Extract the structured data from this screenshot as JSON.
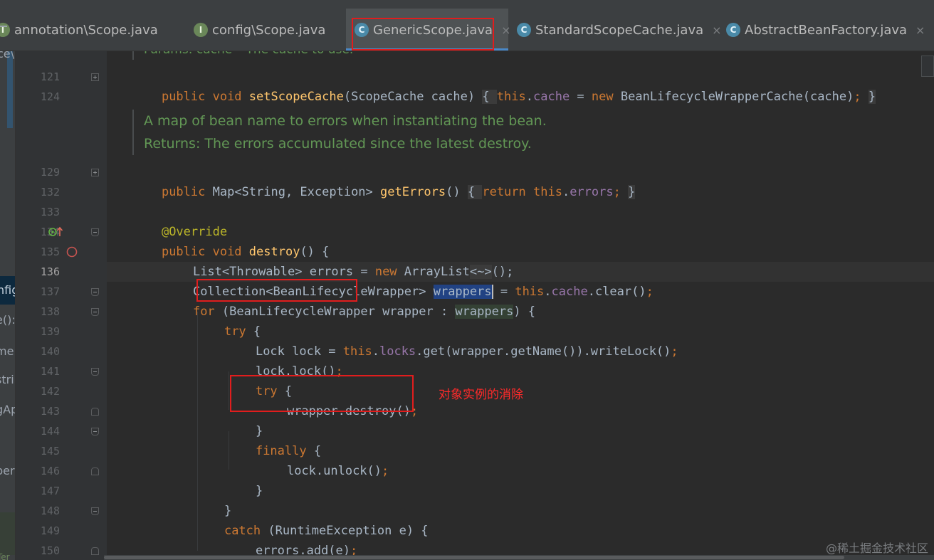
{
  "tabs": [
    {
      "label": "annotation\\Scope.java",
      "kind": "interface"
    },
    {
      "label": "config\\Scope.java",
      "kind": "interface"
    },
    {
      "label": "GenericScope.java",
      "kind": "class",
      "active": true
    },
    {
      "label": "StandardScopeCache.java",
      "kind": "class"
    },
    {
      "label": "AbstractBeanFactory.java",
      "kind": "class"
    }
  ],
  "tab_icon_letters": {
    "interface": "I",
    "class": "C"
  },
  "left_strip": [
    "ce\\",
    "nfig",
    "e():",
    "me",
    "stri",
    "gAp",
    "per",
    "Ter"
  ],
  "doc_partial": "Params: cache – The cache to use.",
  "line_numbers": [
    "121",
    "124",
    "129",
    "132",
    "133",
    "134",
    "135",
    "136",
    "137",
    "138",
    "139",
    "140",
    "141",
    "142",
    "143",
    "144",
    "145",
    "146",
    "147",
    "148",
    "149",
    "150"
  ],
  "doc_comment": {
    "line1": "A map of bean name to errors when instantiating the bean.",
    "line2": "Returns: The errors accumulated since the latest destroy."
  },
  "code": {
    "l121_a": "public void ",
    "l121_fn": "setScopeCache",
    "l121_b": "(ScopeCache cache) ",
    "l121_c": "{ ",
    "l121_d": "this",
    "l121_e": ".",
    "l121_f": "cache",
    "l121_g": " = ",
    "l121_h": "new ",
    "l121_i": "BeanLifecycleWrapperCache(cache)",
    "l121_j": "; ",
    "l121_k": "}",
    "l129_a": "public ",
    "l129_b": "Map<String, Exception> ",
    "l129_fn": "getErrors",
    "l129_c": "() ",
    "l129_d": "{ ",
    "l129_e": "return this",
    "l129_f": ".",
    "l129_g": "errors",
    "l129_h": "; ",
    "l129_i": "}",
    "l133": "@Override",
    "l134_a": "public void ",
    "l134_fn": "destroy",
    "l134_b": "() {",
    "l135_a": "List<Throwable> errors = ",
    "l135_b": "new ",
    "l135_c": "ArrayList",
    "l135_d": "<~>",
    "l135_e": "();",
    "l136_a": "Collection<BeanLifecycleWrapper> ",
    "l136_b": "wrappers",
    "l136_c": " = ",
    "l136_d": "this",
    "l136_e": ".",
    "l136_f": "cache",
    "l136_g": ".clear()",
    "l136_h": ";",
    "l137_a": "for ",
    "l137_b": "(BeanLifecycleWrapper wrapper : ",
    "l137_c": "wrappers",
    "l137_d": ") {",
    "l138_a": "try ",
    "l138_b": "{",
    "l139_a": "Lock lock = ",
    "l139_b": "this",
    "l139_c": ".",
    "l139_d": "locks",
    "l139_e": ".get(wrapper.getName()).writeLock()",
    "l139_f": ";",
    "l140_a": "lock.lock()",
    "l140_b": ";",
    "l141_a": "try ",
    "l141_b": "{",
    "l142_a": "wrapper.destroy()",
    "l142_b": ";",
    "l143": "}",
    "l144_a": "finally ",
    "l144_b": "{",
    "l145_a": "lock.unlock()",
    "l145_b": ";",
    "l146": "}",
    "l147": "}",
    "l148_a": "catch ",
    "l148_b": "(RuntimeException e) {",
    "l149_a": "errors.add(e)",
    "l149_b": ";",
    "l150": "}"
  },
  "annotation_note": "对象实例的消除",
  "watermark": "@稀土掘金技术社区",
  "colors": {
    "keyword": "#cc7832",
    "function": "#ffc66d",
    "field": "#9876aa",
    "annotation": "#bbb529",
    "doc": "#629755",
    "highlight_box": "#e11d1d"
  }
}
